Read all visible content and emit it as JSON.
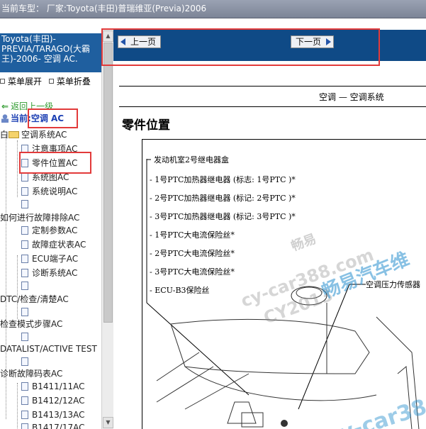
{
  "titlebar": {
    "text": "当前车型：  厂家:Toyota(丰田)普瑞维亚(Previa)2006"
  },
  "left_panel": {
    "header": "Toyota(丰田)-PREVIA/TARAGO(大霸王)-2006- 空调 AC.",
    "expand_menu": "菜单展开",
    "collapse_menu": "菜单折叠",
    "back_link": "返回上一级",
    "current_prefix": "当前:",
    "current_value": "空调 AC",
    "tree": [
      {
        "label": "空调系统AC",
        "type": "folder"
      },
      {
        "label": "注意事项AC",
        "type": "doc"
      },
      {
        "label": "零件位置AC",
        "type": "doc",
        "selected": true
      },
      {
        "label": "系统图AC",
        "type": "doc"
      },
      {
        "label": "系统说明AC",
        "type": "doc"
      },
      {
        "label": "",
        "type": "doc"
      },
      {
        "label": "如何进行故障排除AC",
        "type": "section"
      },
      {
        "label": "定制参数AC",
        "type": "doc"
      },
      {
        "label": "故障症状表AC",
        "type": "doc"
      },
      {
        "label": "ECU端子AC",
        "type": "doc"
      },
      {
        "label": "诊断系统AC",
        "type": "doc"
      },
      {
        "label": "",
        "type": "doc"
      },
      {
        "label": "DTC/检查/清楚AC",
        "type": "section"
      },
      {
        "label": "",
        "type": "doc"
      },
      {
        "label": "检查模式步骤AC",
        "type": "section"
      },
      {
        "label": "",
        "type": "doc"
      },
      {
        "label": "DATALIST/ACTIVE TEST",
        "type": "section"
      },
      {
        "label": "",
        "type": "doc"
      },
      {
        "label": "诊断故障码表AC",
        "type": "section"
      },
      {
        "label": "B1411/11AC",
        "type": "doc"
      },
      {
        "label": "B1412/12AC",
        "type": "doc"
      },
      {
        "label": "B1413/13AC",
        "type": "doc"
      },
      {
        "label": "B1417/17AC",
        "type": "doc"
      }
    ]
  },
  "viewer": {
    "prev_page": "上一页",
    "next_page": "下一页",
    "doc_header": "空调 — 空调系统",
    "doc_title": "零件位置",
    "annotation_group": "发动机室2号继电器盒",
    "annotation_items": [
      "- 1号PTC加热器继电器 (标志: 1号PTC )*",
      "- 2号PTC加热器继电器 (标记: 2号PTC )*",
      "- 3号PTC加热器继电器 (标记: 3号PTC )*",
      "- 1号PTC大电流保险丝*",
      "- 2号PTC大电流保险丝*",
      "- 3号PTC大电流保险丝*",
      "- ECU-B3保险丝"
    ],
    "annotation_right": "空调压力传感器",
    "watermarks": [
      "畅易",
      "cy-car388.com",
      "CY2013",
      "畅易汽车维",
      "cy-car38"
    ]
  },
  "colors": {
    "header_blue": "#1f5f9f",
    "navbar_blue": "#0f4a86",
    "highlight_red": "#e23a3a",
    "link_green": "#2f9b2f",
    "current_blue": "#1b3fb3"
  }
}
